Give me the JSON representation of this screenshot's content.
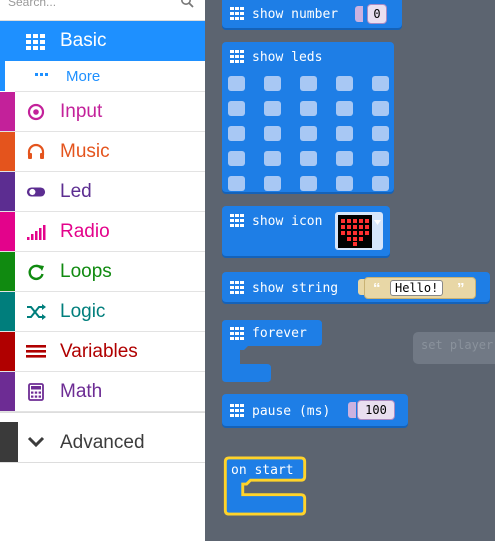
{
  "search": {
    "placeholder": "Search..."
  },
  "toolbox": {
    "selected": {
      "label": "Basic",
      "color": "#1e90ff",
      "icon": "grid-icon"
    },
    "more": {
      "label": "More",
      "color": "#1e90ff",
      "icon": "dots-icon"
    },
    "categories": [
      {
        "label": "Input",
        "color": "#c3219a",
        "icon": "target-icon"
      },
      {
        "label": "Music",
        "color": "#e4541d",
        "icon": "headphones-icon"
      },
      {
        "label": "Led",
        "color": "#5c2d91",
        "icon": "toggle-icon"
      },
      {
        "label": "Radio",
        "color": "#e3038b",
        "icon": "signal-bars-icon"
      },
      {
        "label": "Loops",
        "color": "#108a10",
        "icon": "refresh-icon"
      },
      {
        "label": "Logic",
        "color": "#007e7c",
        "icon": "shuffle-icon"
      },
      {
        "label": "Variables",
        "color": "#b00000",
        "icon": "list-lines-icon"
      },
      {
        "label": "Math",
        "color": "#6d2c94",
        "icon": "calculator-icon"
      }
    ],
    "advanced": {
      "label": "Advanced",
      "color": "#3c3c3c",
      "icon": "chevron-down-icon"
    }
  },
  "blocks": {
    "show_number": {
      "label": "show number",
      "value": "0"
    },
    "show_leds": {
      "label": "show leds"
    },
    "show_icon": {
      "label": "show icon"
    },
    "show_string": {
      "label": "show string",
      "value": "Hello!"
    },
    "forever": {
      "label": "forever"
    },
    "pause": {
      "label": "pause (ms)",
      "value": "100"
    },
    "on_start": {
      "label": "on start",
      "color": "#ffd32a"
    },
    "ghost_block": {
      "label": "set player"
    }
  },
  "colors": {
    "block": "#1e7ee6",
    "workspace": "#5c6470",
    "led_off": "#a8c8f4"
  }
}
